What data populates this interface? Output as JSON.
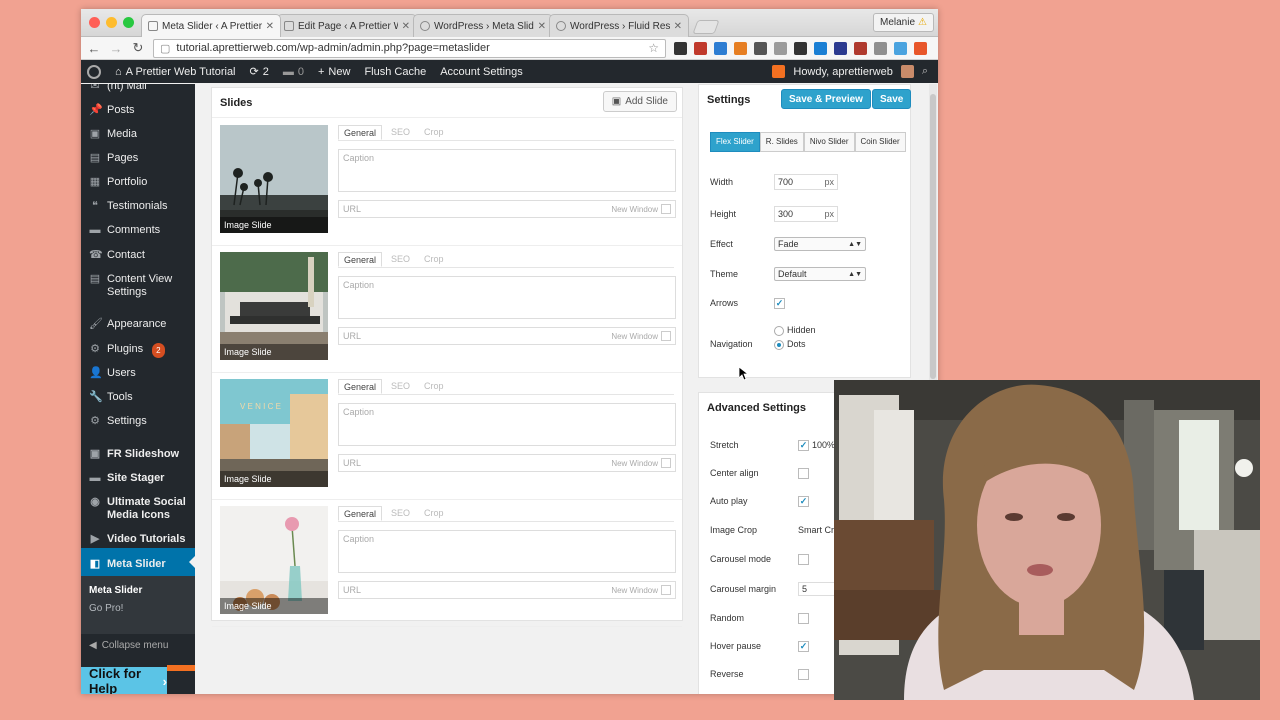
{
  "browser": {
    "tabs": [
      {
        "title": "Meta Slider ‹ A Prettier We",
        "active": true
      },
      {
        "title": "Edit Page ‹ A Prettier Web",
        "active": false
      },
      {
        "title": "WordPress › Meta Slider «",
        "active": false
      },
      {
        "title": "WordPress › Fluid Respon",
        "active": false
      }
    ],
    "profile": "Melanie",
    "url": "tutorial.aprettierweb.com/wp-admin/admin.php?page=metaslider",
    "extension_colors": [
      "#333333",
      "#c0392b",
      "#2d7dd2",
      "#e67e22",
      "#555555",
      "#9b9b9b",
      "#333333",
      "#1a7fd4",
      "#2b3a8f",
      "#b03a2e",
      "#8f8f8f",
      "#4aa3df",
      "#e8562a"
    ]
  },
  "adminbar": {
    "site_name": "A Prettier Web Tutorial",
    "updates": "2",
    "comments": "0",
    "new_label": "New",
    "flush_cache": "Flush Cache",
    "account_settings": "Account Settings",
    "howdy": "Howdy, aprettierweb"
  },
  "sidebar": {
    "items": [
      {
        "label": "(ht) Mail",
        "icon": "mail-icon",
        "top": 0
      },
      {
        "label": "Posts",
        "icon": "pin-icon"
      },
      {
        "label": "Media",
        "icon": "media-icon"
      },
      {
        "label": "Pages",
        "icon": "pages-icon"
      },
      {
        "label": "Portfolio",
        "icon": "portfolio-icon"
      },
      {
        "label": "Testimonials",
        "icon": "testimonials-icon"
      },
      {
        "label": "Comments",
        "icon": "comments-icon"
      },
      {
        "label": "Contact",
        "icon": "contact-icon"
      },
      {
        "label": "Content View Settings",
        "icon": "content-view-icon"
      },
      {
        "label": "Appearance",
        "icon": "appearance-icon"
      },
      {
        "label": "Plugins",
        "icon": "plugins-icon",
        "badge": "2"
      },
      {
        "label": "Users",
        "icon": "users-icon"
      },
      {
        "label": "Tools",
        "icon": "tools-icon"
      },
      {
        "label": "Settings",
        "icon": "settings-icon"
      },
      {
        "label": "FR Slideshow",
        "icon": "slideshow-icon"
      },
      {
        "label": "Site Stager",
        "icon": "stager-icon"
      },
      {
        "label": "Ultimate Social Media Icons",
        "icon": "social-icon"
      },
      {
        "label": "Video Tutorials",
        "icon": "video-icon"
      },
      {
        "label": "Meta Slider",
        "icon": "metaslider-icon",
        "active": true
      }
    ],
    "submenu": [
      "Meta Slider",
      "Go Pro!"
    ],
    "collapse": "Collapse menu",
    "help": "Click for Help",
    "help_arrow": "›",
    "accent": "#0073aa"
  },
  "slides": {
    "title": "Slides",
    "add_slide": "Add Slide",
    "tab_labels": [
      "General",
      "SEO",
      "Crop"
    ],
    "caption_placeholder": "Caption",
    "url_placeholder": "URL",
    "new_window": "New Window",
    "items": [
      {
        "label": "Image Slide",
        "scene": "palm-beach"
      },
      {
        "label": "Image Slide",
        "scene": "patio"
      },
      {
        "label": "Image Slide",
        "scene": "venice-street"
      },
      {
        "label": "Image Slide",
        "scene": "flower-vase"
      }
    ]
  },
  "settings": {
    "title": "Settings",
    "save_preview": "Save & Preview",
    "save": "Save",
    "slider_types": [
      "Flex Slider",
      "R. Slides",
      "Nivo Slider",
      "Coin Slider"
    ],
    "width_label": "Width",
    "width": "700",
    "height_label": "Height",
    "height": "300",
    "unit": "px",
    "effect_label": "Effect",
    "effect": "Fade",
    "theme_label": "Theme",
    "theme": "Default",
    "arrows_label": "Arrows",
    "navigation_label": "Navigation",
    "nav_hidden": "Hidden",
    "nav_dots": "Dots"
  },
  "advanced": {
    "title": "Advanced Settings",
    "stretch_label": "Stretch",
    "stretch_value": "100%",
    "center_label": "Center align",
    "autoplay_label": "Auto play",
    "crop_label": "Image Crop",
    "crop_value": "Smart Crop",
    "carousel_label": "Carousel mode",
    "margin_label": "Carousel margin",
    "margin_value": "5",
    "random_label": "Random",
    "hover_label": "Hover pause",
    "reverse_label": "Reverse"
  }
}
